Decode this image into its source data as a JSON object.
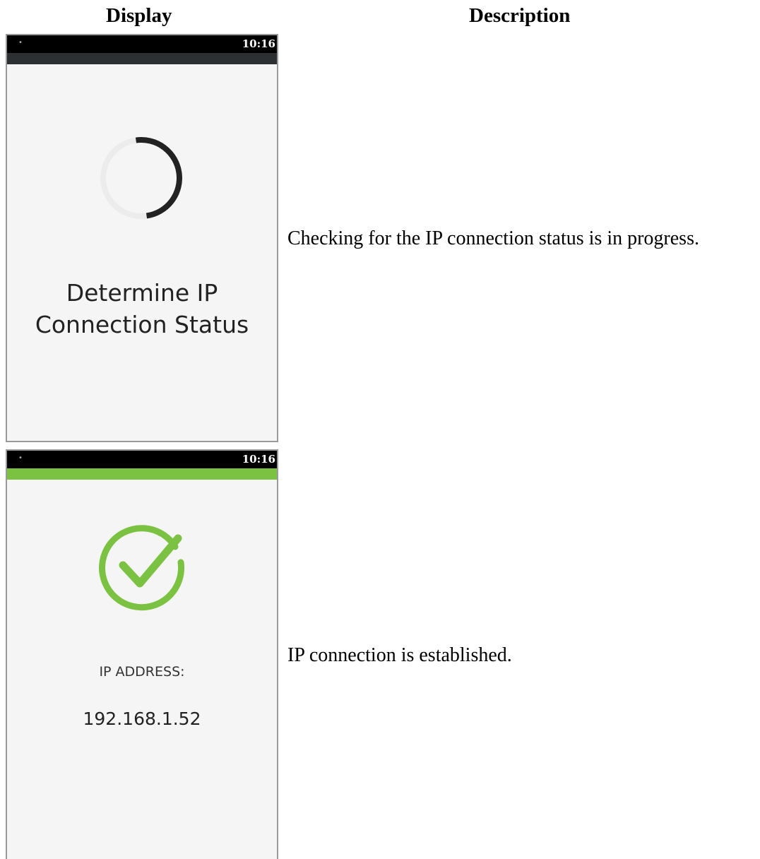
{
  "headers": {
    "display": "Display",
    "description": "Description"
  },
  "rows": [
    {
      "status_time": "10:16",
      "accent_color": "#2d3033",
      "icon": "loading-spinner-icon",
      "title_line1": "Determine IP",
      "title_line2": "Connection Status",
      "description": "Checking for the IP connection status is in progress."
    },
    {
      "status_time": "10:16",
      "accent_color": "#7cc242",
      "icon": "checkmark-circle-icon",
      "ip_label": "IP ADDRESS:",
      "ip_value": "192.168.1.52",
      "description": "IP connection is established."
    }
  ],
  "colors": {
    "status_bar": "#000000",
    "screen_background": "#f5f5f5",
    "success_green": "#7cc242",
    "spinner": "#222222"
  }
}
